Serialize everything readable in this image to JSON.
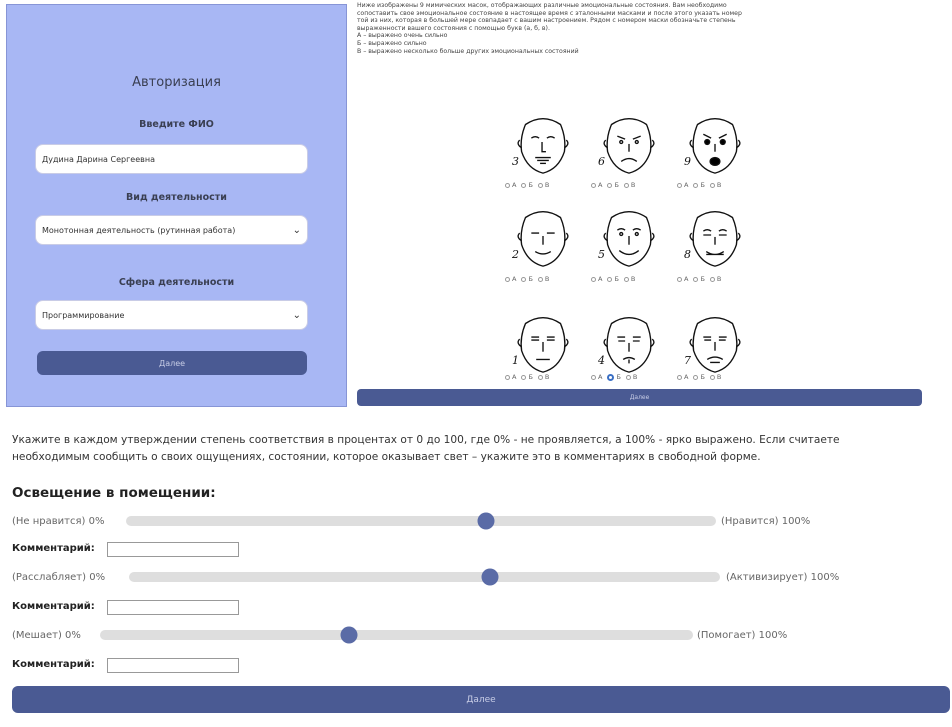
{
  "auth": {
    "title": "Авторизация",
    "name_label": "Введите ФИО",
    "name_value": "Дудина Дарина Сергеевна",
    "activity_label": "Вид деятельности",
    "activity_value": "Монотонная деятельность (рутинная работа)",
    "sphere_label": "Сфера деятельности",
    "sphere_value": "Программирование",
    "next_label": "Далее"
  },
  "masks": {
    "instruction": [
      "Ниже изображены 9 мимических масок, отображающих различные эмоциональные состояния. Вам необходимо",
      "сопоставить свое эмоциональное состояние в настоящее время с эталонными масками и после этого указать номер",
      "той из них, которая в большей мере совпадает с вашим настроением. Рядом с номером маски обозначьте степень",
      "выраженности вашего состояния с помощью букв (а, б, в).",
      "А – выражено очень сильно",
      "Б – выражено сильно",
      "В – выражено несколько больше других эмоциональных состояний"
    ],
    "options": [
      "А",
      "Б",
      "В"
    ],
    "items": [
      {
        "number": "3",
        "selected": null
      },
      {
        "number": "6",
        "selected": null
      },
      {
        "number": "9",
        "selected": null
      },
      {
        "number": "2",
        "selected": null
      },
      {
        "number": "5",
        "selected": null
      },
      {
        "number": "8",
        "selected": null
      },
      {
        "number": "1",
        "selected": null
      },
      {
        "number": "4",
        "selected": "Б"
      },
      {
        "number": "7",
        "selected": null
      }
    ],
    "next_label": "Далее"
  },
  "lighting": {
    "instruction_line1": "Укажите в каждом утверждении степень соответствия в процентах от 0 до 100, где 0% - не проявляется, а 100% - ярко выражено. Если считаете",
    "instruction_line2": "необходимым сообщить о своих ощущениях, состоянии, которое оказывает свет – укажите это в комментариях в свободной форме.",
    "title": "Освещение в помещении:",
    "comment_label": "Комментарий:",
    "sliders": [
      {
        "left": "(Не нравится) 0%",
        "right": "(Нравится) 100%",
        "value": 61
      },
      {
        "left": "(Расслабляет) 0%",
        "right": "(Активизирует) 100%",
        "value": 61
      },
      {
        "left": "(Мешает) 0%",
        "right": "(Помогает) 100%",
        "value": 42
      }
    ],
    "next_label": "Далее"
  },
  "colors": {
    "panel": "#a8b7f4",
    "button": "#4a5a93",
    "thumb": "#5a6ba6",
    "track": "#dedede"
  }
}
